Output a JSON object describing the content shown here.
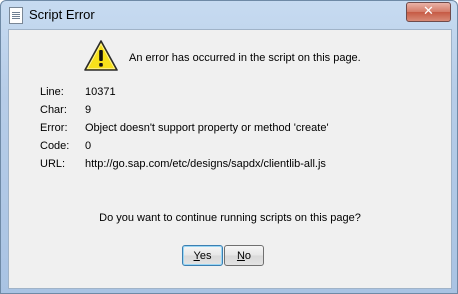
{
  "window": {
    "title": "Script Error",
    "close_label": "✕"
  },
  "dialog": {
    "message": "An error has occurred in the script on this page.",
    "details": [
      {
        "label": "Line:",
        "value": "10371"
      },
      {
        "label": "Char:",
        "value": "9"
      },
      {
        "label": "Error:",
        "value": "Object doesn't support property or method 'create'"
      },
      {
        "label": "Code:",
        "value": "0"
      },
      {
        "label": "URL:",
        "value": "http://go.sap.com/etc/designs/sapdx/clientlib-all.js"
      }
    ],
    "question": "Do you want to continue running scripts on this page?",
    "yes_label_mnemonic": "Y",
    "yes_label_rest": "es",
    "no_label_mnemonic": "N",
    "no_label_rest": "o"
  },
  "icons": {
    "title": "document-icon",
    "warning": "warning-icon"
  }
}
